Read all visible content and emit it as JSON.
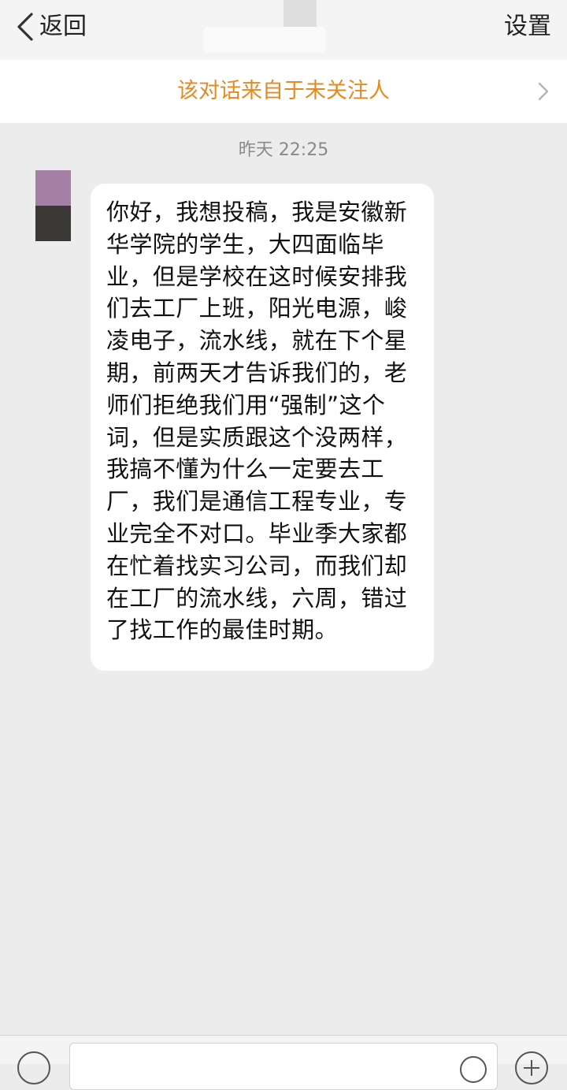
{
  "nav": {
    "back_label": "返回",
    "back_icon": "chevron-left-icon",
    "settings_label": "设置"
  },
  "notice": {
    "text": "该对话来自于未关注人",
    "icon": "chevron-right-icon",
    "color": "#e58a22"
  },
  "chat": {
    "timestamp": "昨天 22:25",
    "messages": [
      {
        "sender": "other",
        "avatar_colors": [
          "#a47fa6",
          "#3a3835"
        ],
        "text": "你好，我想投稿，我是安徽新华学院的学生，大四面临毕业，但是学校在这时候安排我们去工厂上班，阳光电源，峻凌电子，流水线，就在下个星期，前两天才告诉我们的，老师们拒绝我们用“强制”这个词，但是实质跟这个没两样，我搞不懂为什么一定要去工厂，我们是通信工程专业，专业完全不对口。毕业季大家都在忙着找实习公司，而我们却在工厂的流水线，六周，错过了找工作的最佳时期。"
      }
    ]
  },
  "input_bar": {
    "voice_icon": "voice-icon",
    "emoji_icon": "emoji-icon",
    "plus_icon": "plus-icon"
  }
}
